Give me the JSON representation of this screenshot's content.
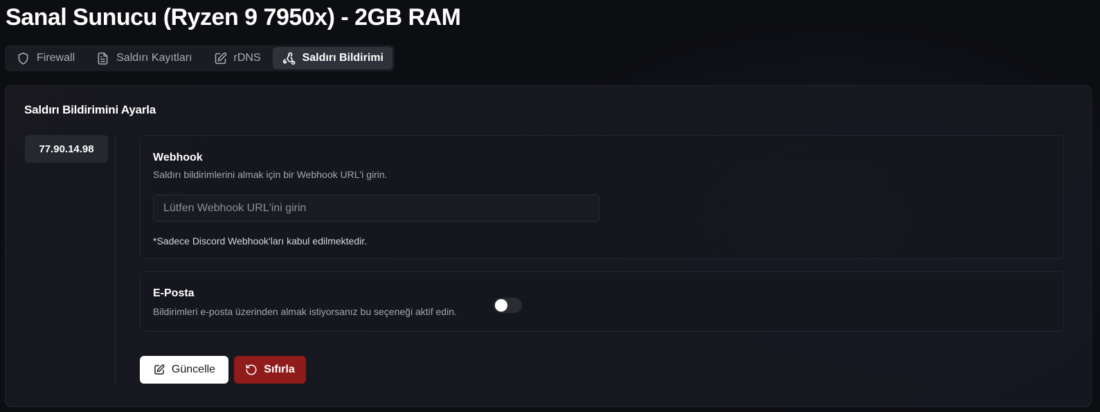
{
  "page": {
    "title": "Sanal Sunucu (Ryzen 9 7950x) - 2GB RAM"
  },
  "tabs": [
    {
      "label": "Firewall",
      "icon": "shield-icon",
      "active": false
    },
    {
      "label": "Saldırı Kayıtları",
      "icon": "file-text-icon",
      "active": false
    },
    {
      "label": "rDNS",
      "icon": "edit-icon",
      "active": false
    },
    {
      "label": "Saldırı Bildirimi",
      "icon": "webhook-icon",
      "active": true
    }
  ],
  "card": {
    "title": "Saldırı Bildirimini Ayarla",
    "ip": "77.90.14.98"
  },
  "webhook": {
    "title": "Webhook",
    "description": "Saldırı bildirimlerini almak için bir Webhook URL'i girin.",
    "placeholder": "Lütfen Webhook URL'ini girin",
    "value": "",
    "note": "*Sadece Discord Webhook'ları kabul edilmektedir."
  },
  "email": {
    "title": "E-Posta",
    "description": "Bildirimleri e-posta üzerinden almak istiyorsanız bu seçeneği aktif edin.",
    "enabled": false
  },
  "actions": {
    "update_label": "Güncelle",
    "reset_label": "Sıfırla"
  },
  "colors": {
    "background": "#0d0e12",
    "reset_button": "#8f1b1b",
    "update_button": "#ffffff",
    "active_tab": "#30323a"
  }
}
